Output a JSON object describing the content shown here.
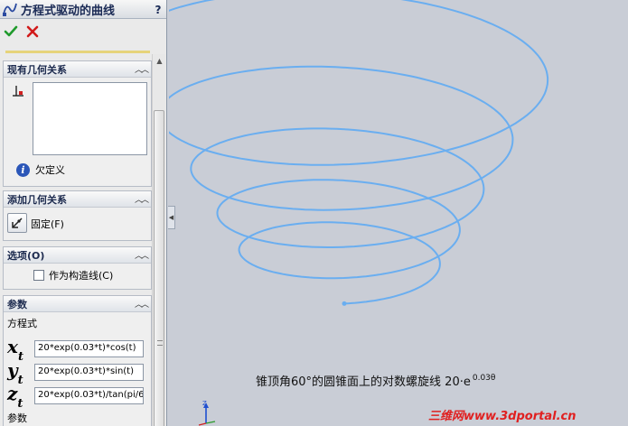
{
  "title": "方程式驱动的曲线",
  "help": "?",
  "groups": {
    "relations": {
      "title": "现有几何关系",
      "status": "欠定义"
    },
    "add_relations": {
      "title": "添加几何关系",
      "fix_label": "固定(F)"
    },
    "options": {
      "title": "选项(O)",
      "construction_label": "作为构造线(C)"
    },
    "params": {
      "title": "参数",
      "equation_label": "方程式",
      "xt": "20*exp(0.03*t)*cos(t)",
      "yt": "20*exp(0.03*t)*sin(t)",
      "zt": "20*exp(0.03*t)/tan(pi/6",
      "param_label": "参数"
    }
  },
  "icons": {
    "title": "sketch-curve-icon",
    "ok": "green-check-icon",
    "cancel": "red-x-icon",
    "relation": "relation-icon",
    "info": "info-icon",
    "fix": "fix-relation-icon"
  },
  "colors": {
    "curve": "#6aaef0",
    "watermark": "#e02020",
    "title": "#1a2a55"
  },
  "caption": {
    "text": "锥顶角60°的圆锥面上的对数螺旋线 20·e",
    "sup": "0.03θ"
  },
  "watermark": "三维网www.3dportal.cn",
  "triad": {
    "z": "Z"
  }
}
